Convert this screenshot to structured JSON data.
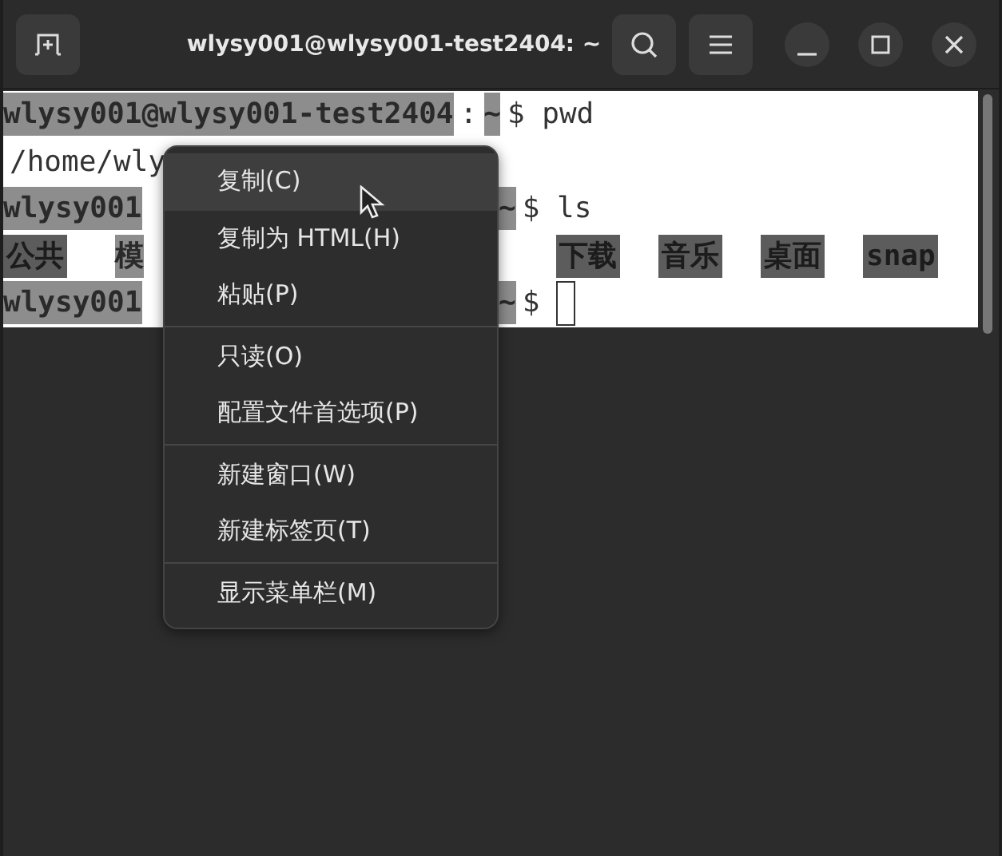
{
  "window": {
    "title": "wlysy001@wlysy001-test2404: ~"
  },
  "terminal": {
    "lines": [
      {
        "left": [
          {
            "text": "wlysy001@wlysy001-test2404",
            "kind": "selected"
          },
          {
            "text": ":",
            "kind": "plain"
          },
          {
            "text": "~",
            "kind": "selected"
          },
          {
            "text": "$ pwd",
            "kind": "plain"
          }
        ]
      },
      {
        "left": [
          {
            "text": "/home/wly",
            "kind": "plain"
          }
        ]
      },
      {
        "left": [
          {
            "text": "wlysy001",
            "kind": "selected"
          }
        ],
        "right": [
          {
            "text": "~",
            "kind": "selected"
          },
          {
            "text": "$ ls",
            "kind": "plain"
          }
        ]
      },
      {
        "left": [
          {
            "text": "公共",
            "kind": "dir"
          },
          {
            "text": "模",
            "kind": "selected"
          }
        ],
        "right": [
          {
            "text": "下载",
            "kind": "dir"
          },
          {
            "text": "音乐",
            "kind": "dir"
          },
          {
            "text": "桌面",
            "kind": "dir"
          },
          {
            "text": "snap",
            "kind": "dir"
          }
        ]
      },
      {
        "left": [
          {
            "text": "wlysy001",
            "kind": "selected"
          }
        ],
        "right": [
          {
            "text": "~",
            "kind": "selected"
          },
          {
            "text": "$",
            "kind": "plain"
          }
        ],
        "cursor": true
      }
    ]
  },
  "context_menu": {
    "groups": [
      [
        {
          "label": "复制(C)",
          "selected": true
        },
        {
          "label": "复制为 HTML(H)",
          "selected": false
        },
        {
          "label": "粘贴(P)",
          "selected": false
        }
      ],
      [
        {
          "label": "只读(O)",
          "selected": false
        },
        {
          "label": "配置文件首选项(P)",
          "selected": false
        }
      ],
      [
        {
          "label": "新建窗口(W)",
          "selected": false
        },
        {
          "label": "新建标签页(T)",
          "selected": false
        }
      ],
      [
        {
          "label": "显示菜单栏(M)",
          "selected": false
        }
      ]
    ]
  }
}
